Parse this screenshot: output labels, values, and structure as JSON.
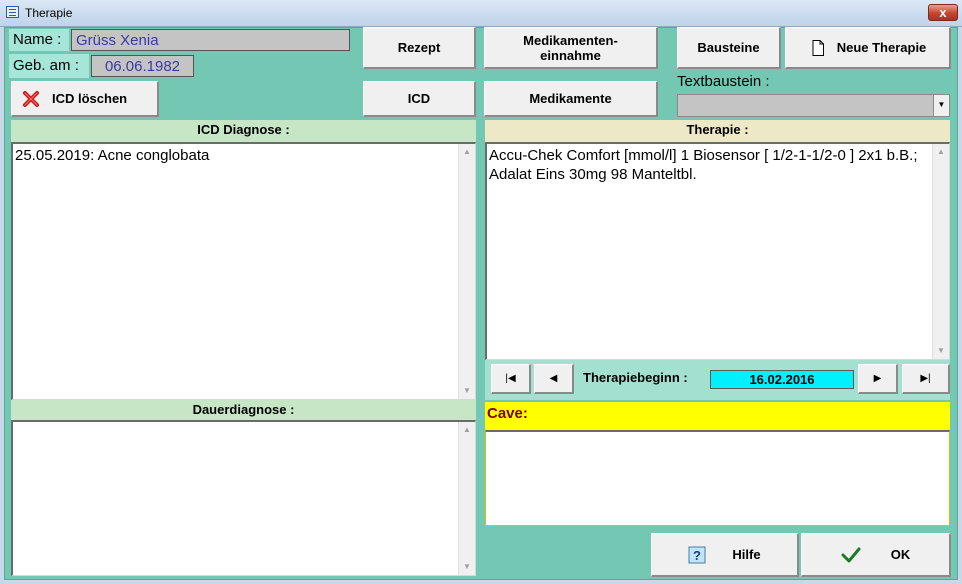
{
  "window": {
    "title": "Therapie",
    "close_glyph": "x"
  },
  "patient": {
    "name_label": "Name :",
    "name_value": "Grüss Xenia",
    "dob_label": "Geb. am :",
    "dob_value": "06.06.1982"
  },
  "buttons": {
    "icd_loeschen": "ICD löschen",
    "rezept": "Rezept",
    "icd": "ICD",
    "medikamenteneinnahme_1": "Medikamenten-",
    "medikamenteneinnahme_2": "einnahme",
    "medikamente": "Medikamente",
    "bausteine": "Bausteine",
    "neue_therapie": "Neue Therapie",
    "hilfe": "Hilfe",
    "ok": "OK"
  },
  "textbaustein": {
    "label": "Textbaustein :",
    "value": ""
  },
  "icd_section": {
    "header": "ICD Diagnose :",
    "text": "25.05.2019: Acne conglobata"
  },
  "dauer_section": {
    "header": "Dauerdiagnose :",
    "text": ""
  },
  "therapie_section": {
    "header": "Therapie :",
    "text": "Accu-Chek Comfort [mmol/l] 1 Biosensor [ 1/2-1-1/2-0 ] 2x1 b.B.; Adalat Eins 30mg 98 Manteltbl."
  },
  "nav": {
    "label": "Therapiebeginn :",
    "date": "16.02.2016"
  },
  "cave": {
    "label": "Cave:",
    "text": ""
  },
  "icons": {
    "close": "close-icon",
    "app": "window-icon",
    "delete": "red-x-icon",
    "new_doc": "document-icon",
    "help": "question-icon",
    "ok": "checkmark-icon",
    "first": "first-record-icon",
    "prev": "previous-record-icon",
    "next": "next-record-icon",
    "last": "last-record-icon"
  },
  "colors": {
    "dialog_bg": "#73c8b4",
    "name_field": "#c4c4c4",
    "date_highlight": "#00f0ff",
    "cave_bg": "#ffff00",
    "cave_text": "#800000"
  }
}
